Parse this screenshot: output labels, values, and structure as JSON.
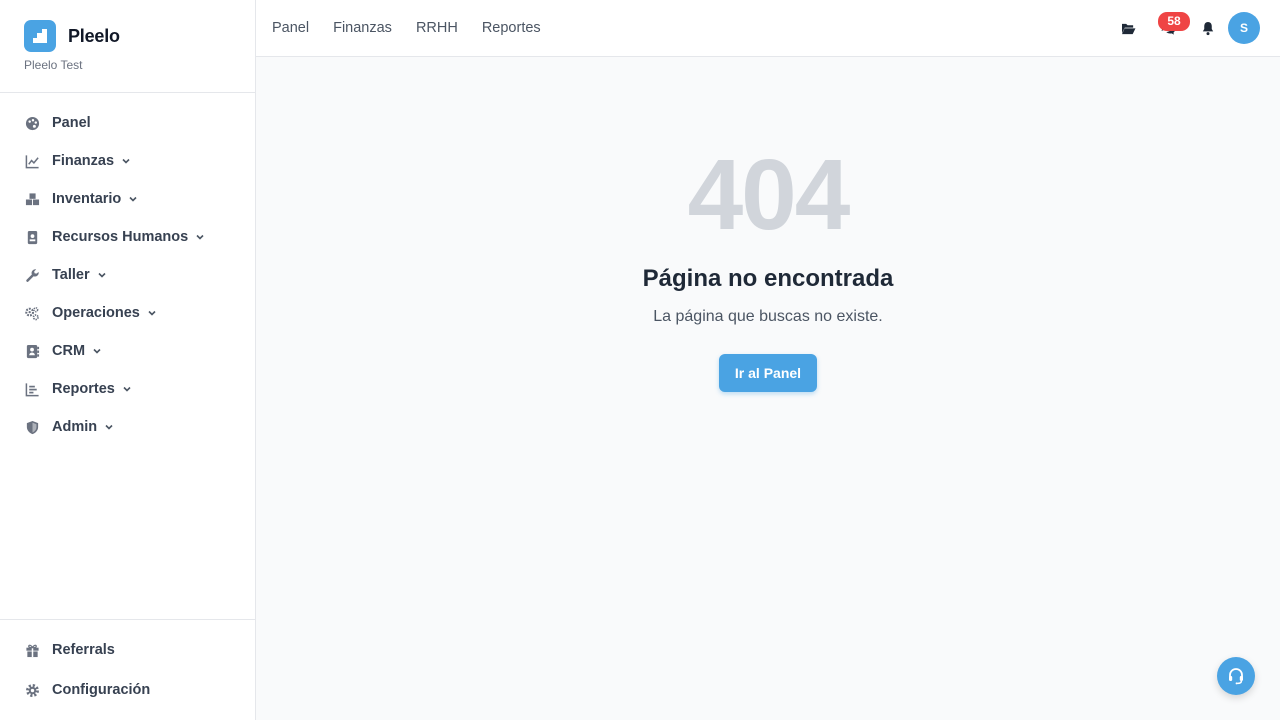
{
  "brand": {
    "name": "Pleelo",
    "subtitle": "Pleelo Test",
    "accent": "#4aa3e3"
  },
  "sidebar": {
    "items": [
      {
        "label": "Panel",
        "icon": "palette-icon",
        "expandable": false
      },
      {
        "label": "Finanzas",
        "icon": "chart-line-icon",
        "expandable": true
      },
      {
        "label": "Inventario",
        "icon": "boxes-icon",
        "expandable": true
      },
      {
        "label": "Recursos Humanos",
        "icon": "id-badge-icon",
        "expandable": true
      },
      {
        "label": "Taller",
        "icon": "wrench-icon",
        "expandable": true
      },
      {
        "label": "Operaciones",
        "icon": "cogs-icon",
        "expandable": true
      },
      {
        "label": "CRM",
        "icon": "address-book-icon",
        "expandable": true
      },
      {
        "label": "Reportes",
        "icon": "bar-chart-icon",
        "expandable": true
      },
      {
        "label": "Admin",
        "icon": "shield-icon",
        "expandable": true
      }
    ],
    "bottom": [
      {
        "label": "Referrals",
        "icon": "gift-icon"
      },
      {
        "label": "Configuración",
        "icon": "gear-icon"
      }
    ]
  },
  "header": {
    "links": [
      "Panel",
      "Finanzas",
      "RRHH",
      "Reportes"
    ],
    "notification_count": "58",
    "avatar_initial": "S"
  },
  "error": {
    "code": "404",
    "title": "Página no encontrada",
    "description": "La página que buscas no existe.",
    "button": "Ir al Panel"
  },
  "colors": {
    "badge": "#ef4444",
    "error_code": "#d1d5db"
  }
}
